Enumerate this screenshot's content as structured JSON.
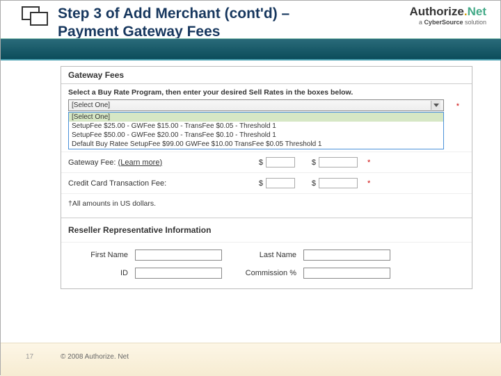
{
  "slide": {
    "title_line1": "Step 3 of Add Merchant (cont'd) –",
    "title_line2": "Payment Gateway Fees"
  },
  "logo": {
    "brand_auth": "Authorize",
    "brand_dot": ".",
    "brand_net": "Net",
    "tagline_prefix": "a ",
    "tagline_bold": "CyberSource",
    "tagline_suffix": " solution"
  },
  "gateway": {
    "section_title": "Gateway Fees",
    "instruction": "Select a Buy Rate Program, then enter your desired Sell Rates in the boxes below.",
    "select_placeholder": "[Select One]",
    "asterisk": "*",
    "dropdown": {
      "selected": "[Select One]",
      "options": [
        "SetupFee $25.00 - GWFee $15.00 - TransFee $0.05 - Threshold 1",
        "SetupFee $50.00 - GWFee $20.00 - TransFee $0.10 - Threshold 1",
        "Default Buy Ratee     SetupFee $99.00    GWFee $10.00    TransFee $0.05    Threshold 1"
      ]
    },
    "rows": {
      "gw_label": "Gateway Fee:",
      "gw_learn": "(Learn more)",
      "cc_label": "Credit Card Transaction Fee:",
      "currency": "$"
    },
    "footnote": "†All amounts in US dollars."
  },
  "rep": {
    "section_title": "Reseller Representative Information",
    "first_name_label": "First Name",
    "last_name_label": "Last Name",
    "id_label": "ID",
    "commission_label": "Commission %",
    "first_name": "",
    "last_name": "",
    "id": "",
    "commission": ""
  },
  "footer": {
    "page": "17",
    "copyright": "© 2008 Authorize. Net"
  }
}
